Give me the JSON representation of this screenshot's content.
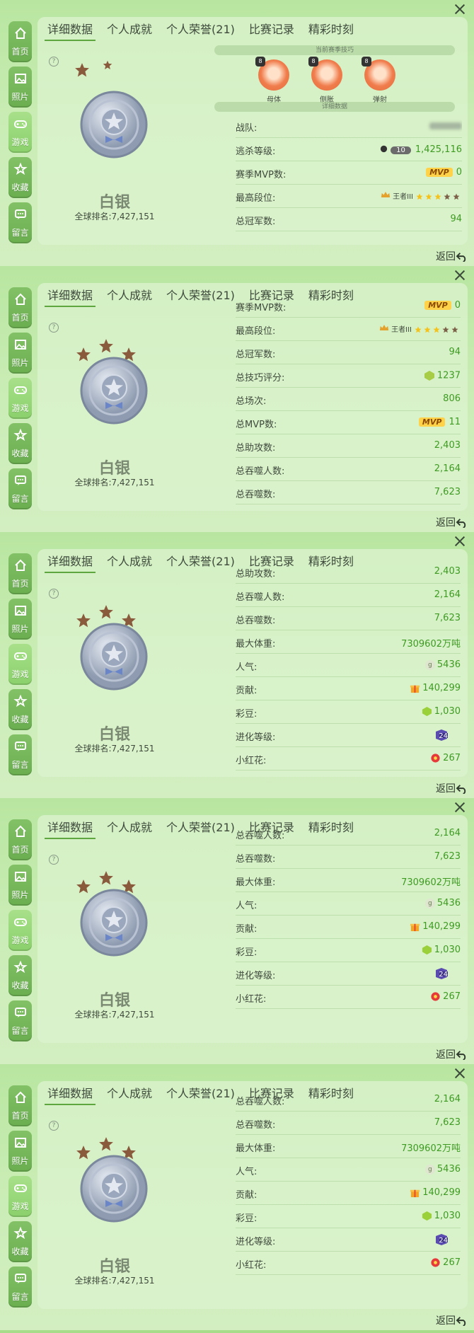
{
  "ui": {
    "close_icon": "close-icon",
    "back_label": "返回",
    "sidebar": [
      {
        "label": "首页",
        "icon": "home-icon"
      },
      {
        "label": "照片",
        "icon": "photo-icon"
      },
      {
        "label": "游戏",
        "icon": "gamepad-icon",
        "active": true
      },
      {
        "label": "收藏",
        "icon": "favorite-icon"
      },
      {
        "label": "留言",
        "icon": "message-icon"
      }
    ],
    "tabs": [
      "详细数据",
      "个人成就",
      "个人荣誉(21)",
      "比赛记录",
      "精彩时刻"
    ],
    "profile": {
      "rank_name": "白银",
      "global_rank": "全球排名:7,427,151",
      "stars_total": 3
    }
  },
  "first_screen": {
    "skills_header": "当前赛季技巧",
    "skills": [
      {
        "name": "母体",
        "level": "8"
      },
      {
        "name": "侧胀",
        "level": "8"
      },
      {
        "name": "弹射",
        "level": "8"
      }
    ],
    "details_header": "详细数据",
    "rows": [
      {
        "label": "战队:",
        "value": ""
      },
      {
        "label": "逃杀等级:",
        "badge": "10",
        "value": "1,425,116"
      },
      {
        "label": "赛季MVP数:",
        "mvp": "MVP",
        "value": "0"
      },
      {
        "label": "最高段位:",
        "rank_text": "王者III",
        "stars_lit": 3,
        "stars_total": 5
      },
      {
        "label": "总冠军数:",
        "value": "94"
      }
    ]
  },
  "stats": {
    "season_mvp": {
      "label": "赛季MVP数:",
      "mvp": "MVP",
      "value": "0"
    },
    "highest_rank": {
      "label": "最高段位:",
      "rank_text": "王者III",
      "stars_lit": 3,
      "stars_total": 5
    },
    "champions": {
      "label": "总冠军数:",
      "value": "94"
    },
    "skill_score": {
      "label": "总技巧评分:",
      "value": "1237"
    },
    "matches": {
      "label": "总场次:",
      "value": "806"
    },
    "total_mvp": {
      "label": "总MVP数:",
      "mvp": "MVP",
      "value": "11"
    },
    "assists": {
      "label": "总助攻数:",
      "value": "2,403"
    },
    "devoured_players": {
      "label": "总吞噬人数:",
      "value": "2,164"
    },
    "devoured": {
      "label": "总吞噬数:",
      "value": "7,623"
    },
    "max_weight": {
      "label": "最大体重:",
      "value": "7309602万吨"
    },
    "popularity": {
      "label": "人气:",
      "icon_text": "g",
      "value": "5436"
    },
    "contribution": {
      "label": "贡献:",
      "value": "140,299"
    },
    "beans": {
      "label": "彩豆:",
      "value": "1,030"
    },
    "evolution": {
      "label": "进化等级:",
      "value": "24"
    },
    "flowers": {
      "label": "小红花:",
      "value": "267"
    }
  }
}
